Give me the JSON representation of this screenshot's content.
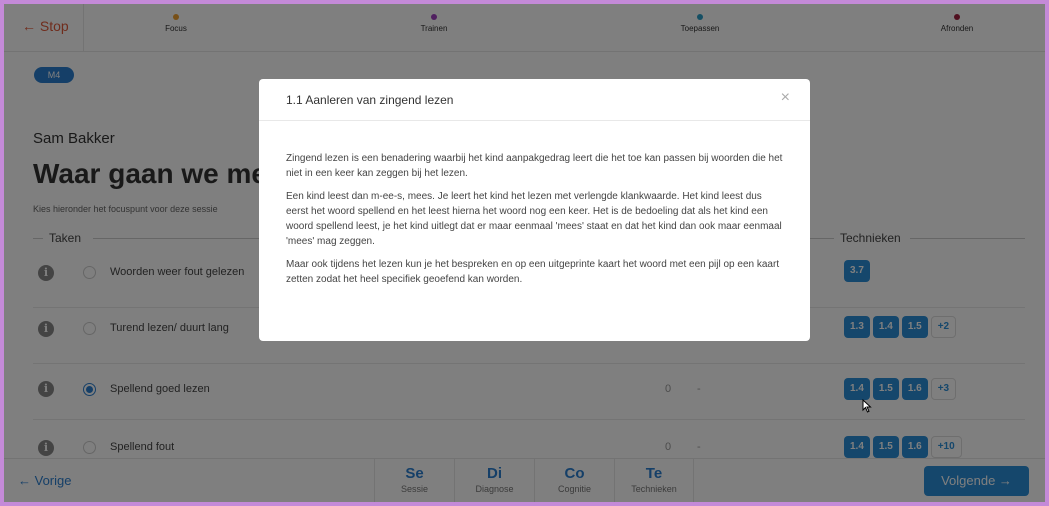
{
  "nav": {
    "stop_label": "← Stop",
    "steps": [
      {
        "label": "Focus",
        "color": "#f0a030"
      },
      {
        "label": "Trainen",
        "color": "#a040c0"
      },
      {
        "label": "Toepassen",
        "color": "#2b9fc8"
      },
      {
        "label": "Afronden",
        "color": "#a02040"
      }
    ]
  },
  "badge": "M4",
  "student_name": "Sam Bakker",
  "headline": "Waar gaan we mee",
  "hint": "Kies hieronder het focuspunt voor deze sessie",
  "sections": {
    "tasks": "Taken",
    "techniques": "Technieken"
  },
  "rows": [
    {
      "label": "Woorden weer fout gelezen",
      "count": "",
      "dash": "",
      "selected": false,
      "techs": [
        "3.7"
      ],
      "more": ""
    },
    {
      "label": "Turend lezen/ duurt lang",
      "count": "",
      "dash": "",
      "selected": false,
      "techs": [
        "1.3",
        "1.4",
        "1.5"
      ],
      "more": "+2"
    },
    {
      "label": "Spellend goed lezen",
      "count": "0",
      "dash": "-",
      "selected": true,
      "techs": [
        "1.4",
        "1.5",
        "1.6"
      ],
      "more": "+3"
    },
    {
      "label": "Spellend fout",
      "count": "0",
      "dash": "-",
      "selected": false,
      "techs": [
        "1.4",
        "1.5",
        "1.6"
      ],
      "more": "+10"
    }
  ],
  "bottom": {
    "prev_label": "← Vorige",
    "next_label": "Volgende →",
    "tabs": [
      {
        "abbr": "Se",
        "full": "Sessie"
      },
      {
        "abbr": "Di",
        "full": "Diagnose"
      },
      {
        "abbr": "Co",
        "full": "Cognitie"
      },
      {
        "abbr": "Te",
        "full": "Technieken"
      }
    ]
  },
  "modal": {
    "title": "1.1 Aanleren van zingend lezen",
    "close": "×",
    "paragraphs": [
      "Zingend lezen is een benadering waarbij het kind aanpakgedrag leert die het toe kan passen bij woorden die het niet in een keer kan zeggen bij het lezen.",
      "Een kind leest dan m-ee-s, mees. Je leert het kind het lezen met verlengde klankwaarde. Het kind leest dus eerst het woord spellend en het leest hierna het woord nog een keer. Het is de bedoeling dat als het kind een woord spellend leest, je het kind uitlegt dat er maar eenmaal 'mees' staat en dat het kind dan ook maar eenmaal 'mees' mag zeggen.",
      "Maar ook tijdens het lezen kun je het bespreken en op een uitgeprinte kaart het woord met een pijl op een kaart zetten zodat het heel specifiek geoefend kan worden."
    ]
  }
}
